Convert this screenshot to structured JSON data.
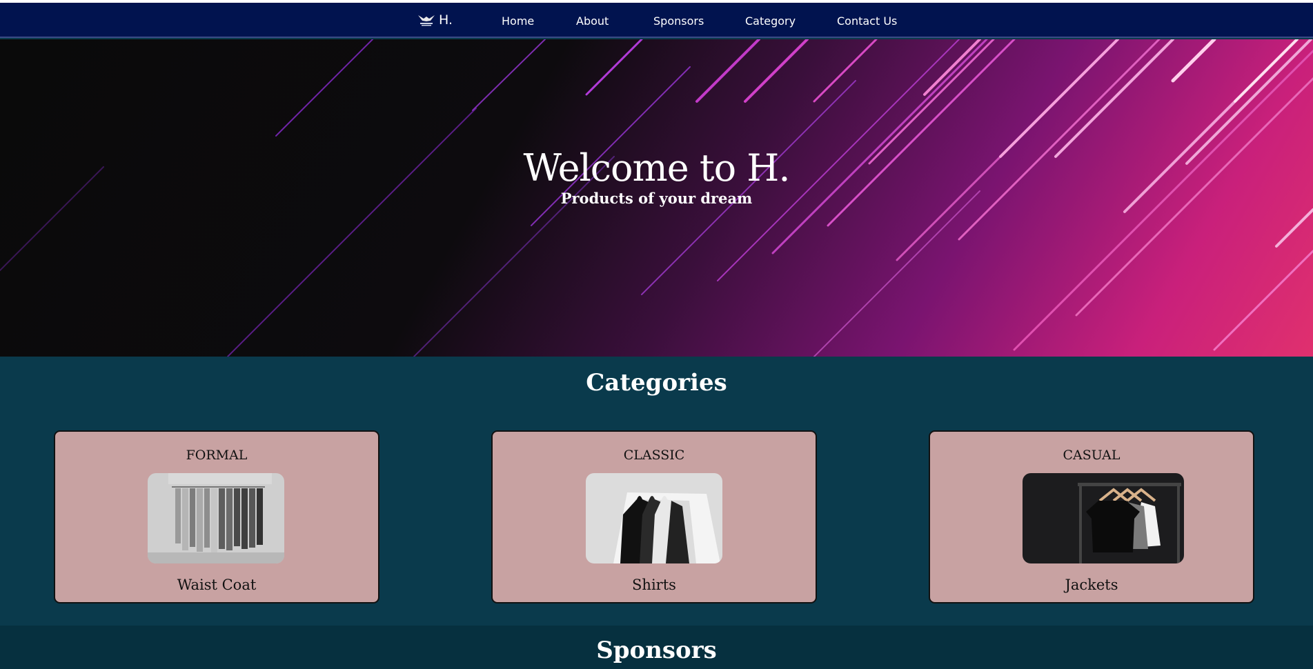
{
  "nav": {
    "brand": "H.",
    "links": [
      "Home",
      "About",
      "Sponsors",
      "Category",
      "Contact Us"
    ]
  },
  "hero": {
    "title": "Welcome to H.",
    "subtitle": "Products of your dream"
  },
  "categories": {
    "title": "Categories",
    "cards": [
      {
        "heading": "FORMAL",
        "item": "Waist Coat"
      },
      {
        "heading": "CLASSIC",
        "item": "Shirts"
      },
      {
        "heading": "CASUAL",
        "item": "Jackets"
      }
    ]
  },
  "sponsors": {
    "title": "Sponsors"
  },
  "colors": {
    "navbar": "#01134f",
    "section_bg": "#0a3a4c",
    "card_bg": "#c8a2a2",
    "hero_accent": "#e0306e"
  }
}
